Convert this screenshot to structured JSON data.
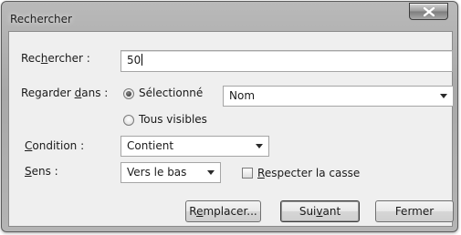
{
  "window": {
    "title": "Rechercher",
    "close_icon": "close-icon"
  },
  "search": {
    "label_before": "Rec",
    "label_mnemonic": "h",
    "label_after": "ercher :",
    "value": "50"
  },
  "look_in": {
    "label_before": "Regarder ",
    "label_mnemonic": "d",
    "label_after": "ans :",
    "option_selected": "Sélectionné",
    "option_all_visible": "Tous visibles",
    "selected_option": "Sélectionné",
    "column_value": "Nom"
  },
  "condition": {
    "label_mnemonic": "C",
    "label_after": "ondition :",
    "value": "Contient"
  },
  "direction": {
    "label_mnemonic": "S",
    "label_after": "ens :",
    "value": "Vers le bas"
  },
  "match_case": {
    "label_mnemonic": "R",
    "label_after": "especter la casse",
    "checked": false
  },
  "buttons": {
    "replace_before": "R",
    "replace_mnemonic": "e",
    "replace_after": "mplacer...",
    "next_before": "Sui",
    "next_mnemonic": "v",
    "next_after": "ant",
    "close": "Fermer"
  }
}
